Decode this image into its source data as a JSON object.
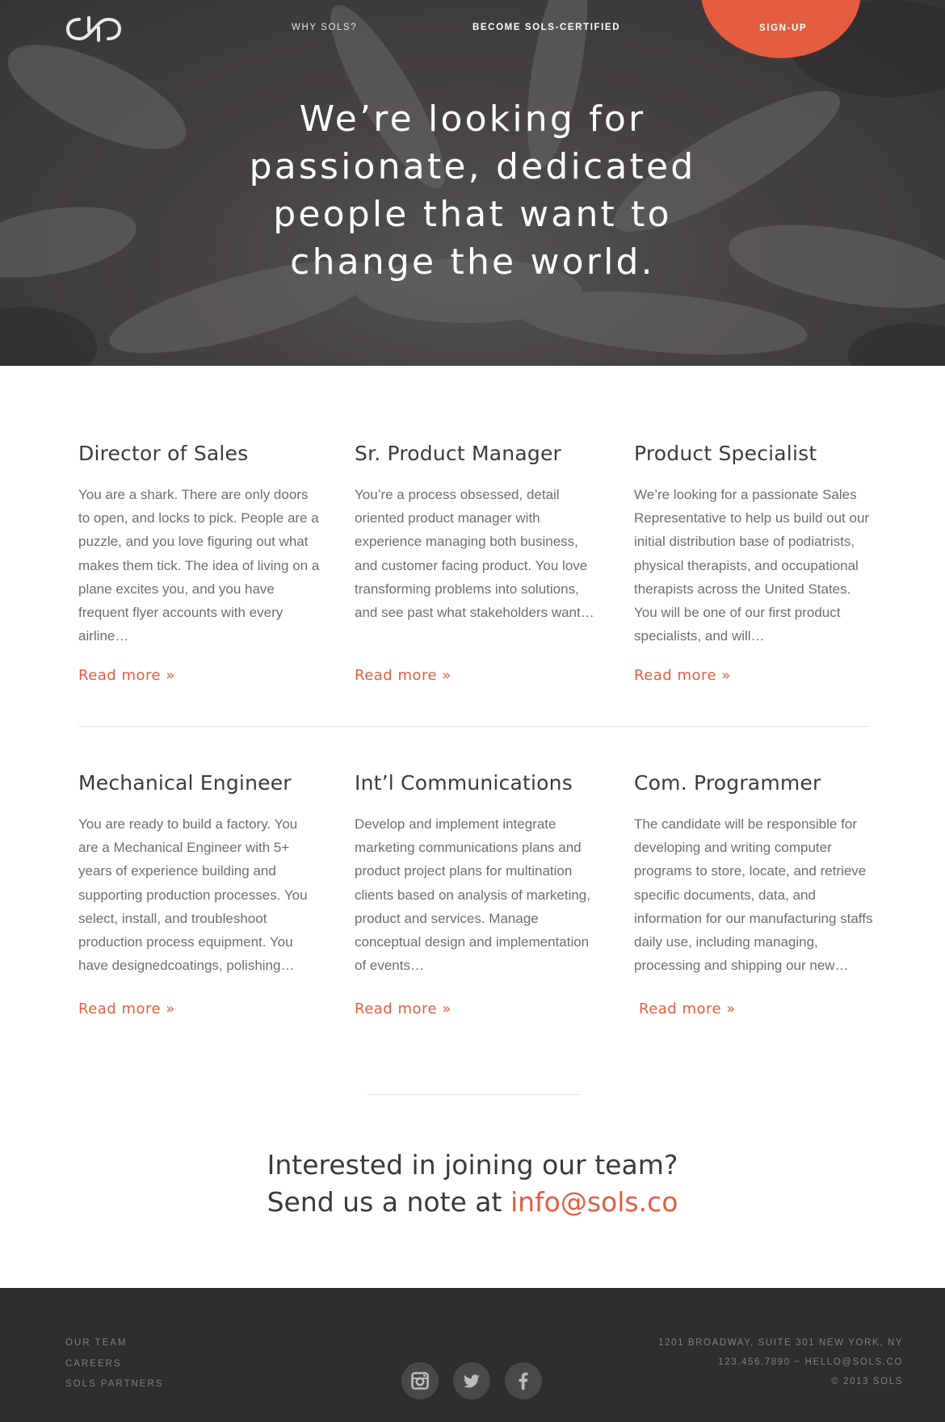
{
  "nav": {
    "why_label": "WHY SOLS?",
    "certified_label": "BECOME SOLS-CERTIFIED",
    "signup_label": "SIGN-UP",
    "logo_icon": "sols-logo-icon"
  },
  "hero": {
    "title": "We’re looking for passionate, dedicated people that want to change the world."
  },
  "jobs": [
    {
      "title": "Director of Sales",
      "description": "You are a shark. There are only doors to open, and locks to pick. People are a puzzle, and you love figuring out what makes them tick. The idea of living on a plane excites you, and you have frequent flyer accounts with every airline…",
      "read_more": "Read more »"
    },
    {
      "title": "Sr. Product Manager",
      "description": "You’re a process obsessed, detail oriented product manager with experience managing both business, and customer facing product. You love transforming problems into solutions, and see past what stakeholders want…",
      "read_more": "Read more »"
    },
    {
      "title": "Product Specialist",
      "description": "We’re looking for a passionate Sales Representative to help us build out our initial distribution base of podiatrists, physical therapists, and occupational therapists across the United States. You will be one of our first product specialists, and will…",
      "read_more": "Read more »"
    },
    {
      "title": "Mechanical Engineer",
      "description": "You are ready to build a factory. You are a Mechanical Engineer with 5+ years of experience building and supporting production processes. You select, install, and troubleshoot production process equipment. You have designedcoatings, polishing…",
      "read_more": "Read more »"
    },
    {
      "title": "Int’l Communications",
      "description": "Develop and implement integrate marketing communications plans and product project plans for multination clients based on analysis of marketing, product and services. Manage conceptual design and implementation of events…",
      "read_more": "Read more »"
    },
    {
      "title": "Com. Programmer",
      "description": "The candidate will be responsible for developing and writing computer programs to store, locate, and retrieve specific documents, data, and information for our manufacturing staffs daily use, including managing, processing and shipping our new…",
      "read_more": "Read more »"
    }
  ],
  "cta": {
    "line1": "Interested in joining our team?",
    "line2_prefix": "Send us a note at ",
    "email": "info@sols.co"
  },
  "footer": {
    "links": [
      "OUR TEAM",
      "CAREERS",
      "SOLS PARTNERS"
    ],
    "social_icons": [
      "instagram-icon",
      "twitter-icon",
      "facebook-icon"
    ],
    "address": "1201 BROADWAY, SUITE 301 NEW YORK, NY",
    "contact": "123.456.7890 ~ HELLO@SOLS.CO",
    "copyright": "© 2013 SOLS"
  },
  "colors": {
    "accent": "#e45d3f",
    "footer_bg": "#2f2d2e",
    "hero_overlay": "#3f3d3e"
  }
}
